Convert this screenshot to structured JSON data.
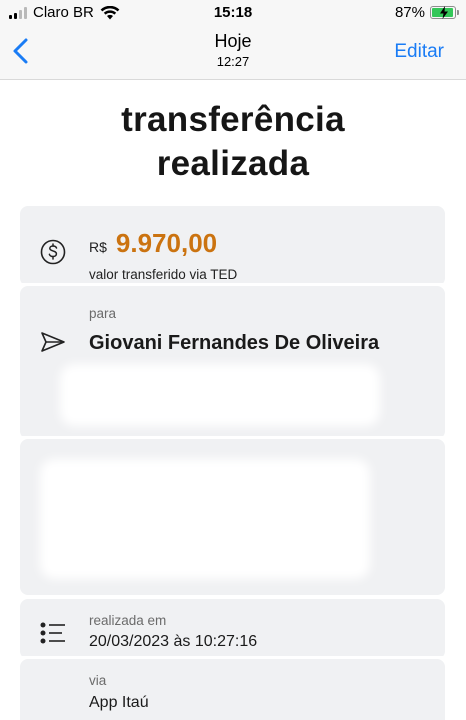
{
  "status_bar": {
    "carrier": "Claro BR",
    "time": "15:18",
    "battery_percent": "87%",
    "battery_level": 0.87
  },
  "nav": {
    "title": "Hoje",
    "subtitle": "12:27",
    "edit_label": "Editar",
    "accent_color": "#1a7cf5"
  },
  "receipt": {
    "headline_line1": "transferência",
    "headline_line2": "realizada",
    "currency": "R$",
    "amount": "9.970,00",
    "amount_color": "#cb7310",
    "transfer_note": "valor transferido via TED",
    "to_label": "para",
    "recipient_name": "Giovani Fernandes De Oliveira",
    "date_label": "realizada em",
    "date_value": "20/03/2023 às 10:27:16",
    "via_label": "via",
    "via_value": "App Itaú"
  }
}
